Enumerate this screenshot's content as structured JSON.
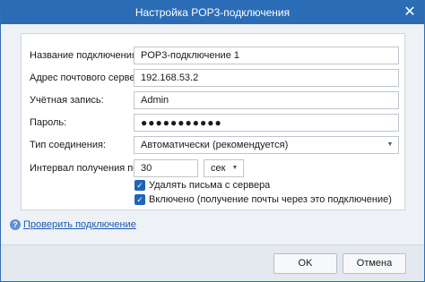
{
  "window": {
    "title": "Настройка POP3-подключения"
  },
  "icons": {
    "close": "close-icon",
    "dropdown": "chevron-down-icon",
    "check": "checkmark-icon",
    "info": "info-icon"
  },
  "form": {
    "connection_name": {
      "label": "Название подключения:",
      "value": "POP3-подключение 1"
    },
    "server_address": {
      "label": "Адрес почтового сервера:",
      "value": "192.168.53.2"
    },
    "account": {
      "label": "Учётная запись:",
      "value": "Admin"
    },
    "password": {
      "label": "Пароль:",
      "value": "●●●●●●●●●●●"
    },
    "connection_type": {
      "label": "Тип соединения:",
      "value": "Автоматически (рекомендуется)"
    },
    "interval": {
      "label": "Интервал получения почты:",
      "value": "30",
      "unit": "сек"
    },
    "delete_from_server": {
      "label": "Удалять письма с сервера",
      "checked": true
    },
    "enabled": {
      "label": "Включено (получение почты через это подключение)",
      "checked": true
    }
  },
  "test_link": {
    "label": "Проверить подключение"
  },
  "buttons": {
    "ok": "OK",
    "cancel": "Отмена"
  },
  "colors": {
    "titlebar": "#2b6cb6",
    "checkbox": "#1f64b8",
    "link": "#1a58b0"
  }
}
